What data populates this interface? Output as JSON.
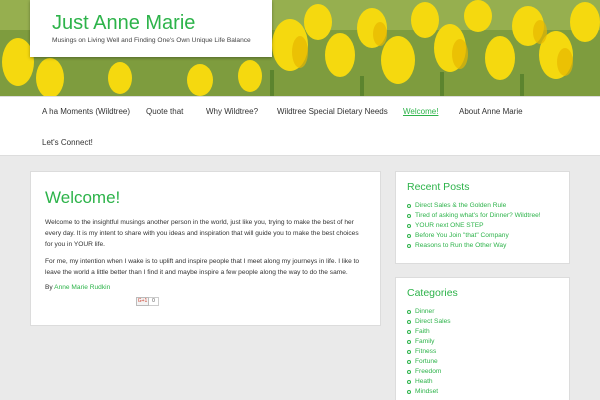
{
  "site": {
    "title": "Just Anne Marie",
    "tagline": "Musings on Living Well and Finding One's Own Unique Life Balance"
  },
  "nav": {
    "items": [
      {
        "label": "A ha Moments (Wildtree)"
      },
      {
        "label": "Quote that"
      },
      {
        "label": "Why Wildtree?"
      },
      {
        "label": "Wildtree Special Dietary Needs"
      },
      {
        "label": "Welcome!"
      },
      {
        "label": "About Anne Marie"
      },
      {
        "label": "Let's Connect!"
      }
    ],
    "active_index": 4
  },
  "post": {
    "title": "Welcome!",
    "paragraph1": "Welcome to the insightful musings another person in the world, just like you, trying to make the best of her every day.  It is my intent to share with you ideas and inspiration that will guide you to make the best choices for you in YOUR life.",
    "paragraph2": "For me, my intention when I wake is to uplift and inspire people that I meet along my journeys in life. I like to leave the world a little better than I find it and maybe inspire a few people along the way to do the same.",
    "byline_prefix": "By",
    "author": "Anne Marie Rudkin",
    "gplus_label": "G+1",
    "gplus_count": "0"
  },
  "sidebar": {
    "recent_posts": {
      "title": "Recent Posts",
      "items": [
        "Direct Sales & the Golden Rule",
        "Tired of asking what's for Dinner? Wildtree!",
        "YOUR next ONE STEP",
        "Before You Join \"that\" Company",
        "Reasons to Run the Other Way"
      ]
    },
    "categories": {
      "title": "Categories",
      "items": [
        "Dinner",
        "Direct Sales",
        "Faith",
        "Family",
        "Fitness",
        "Fortune",
        "Freedom",
        "Heath",
        "Mindset"
      ]
    }
  },
  "colors": {
    "accent": "#2db34a",
    "background": "#eaeaea"
  }
}
